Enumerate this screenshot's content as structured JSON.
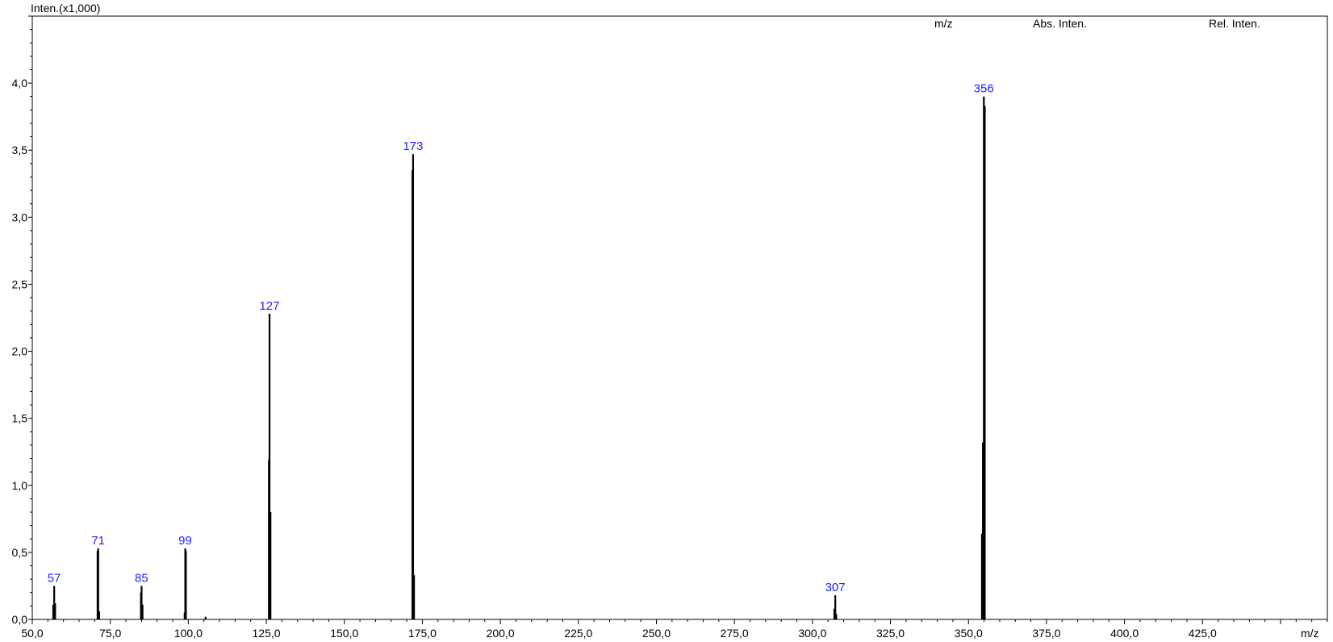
{
  "chart_data": {
    "type": "bar",
    "title": "",
    "ylabel": "Inten.(x1,000)",
    "xlabel": "m/z",
    "xlim": [
      50,
      465
    ],
    "ylim": [
      0,
      4.5
    ],
    "x_ticks": [
      "50,0",
      "75,0",
      "100,0",
      "125,0",
      "150,0",
      "175,0",
      "200,0",
      "225,0",
      "250,0",
      "275,0",
      "300,0",
      "325,0",
      "350,0",
      "375,0",
      "400,0",
      "425,0"
    ],
    "x_tick_values": [
      50,
      75,
      100,
      125,
      150,
      175,
      200,
      225,
      250,
      275,
      300,
      325,
      350,
      375,
      400,
      425
    ],
    "y_ticks": [
      "0,0",
      "0,5",
      "1,0",
      "1,5",
      "2,0",
      "2,5",
      "3,0",
      "3,5",
      "4,0"
    ],
    "y_tick_values": [
      0,
      0.5,
      1.0,
      1.5,
      2.0,
      2.5,
      3.0,
      3.5,
      4.0
    ],
    "header_columns": [
      "m/z",
      "Abs. Inten.",
      "Rel. Inten."
    ],
    "peaks": [
      {
        "mz": 56.7,
        "value": 0.11
      },
      {
        "mz": 57.0,
        "value": 0.25,
        "label": "57"
      },
      {
        "mz": 57.3,
        "value": 0.12
      },
      {
        "mz": 70.9,
        "value": 0.51
      },
      {
        "mz": 71.1,
        "value": 0.53,
        "label": "71"
      },
      {
        "mz": 71.4,
        "value": 0.06
      },
      {
        "mz": 84.8,
        "value": 0.2
      },
      {
        "mz": 85.0,
        "value": 0.25,
        "label": "85"
      },
      {
        "mz": 85.3,
        "value": 0.11
      },
      {
        "mz": 98.8,
        "value": 0.05
      },
      {
        "mz": 99.0,
        "value": 0.53,
        "label": "99"
      },
      {
        "mz": 99.2,
        "value": 0.51
      },
      {
        "mz": 105.5,
        "value": 0.02
      },
      {
        "mz": 125.8,
        "value": 1.19
      },
      {
        "mz": 126.0,
        "value": 2.28,
        "label": "127"
      },
      {
        "mz": 126.3,
        "value": 0.8
      },
      {
        "mz": 171.8,
        "value": 3.35
      },
      {
        "mz": 172.0,
        "value": 3.47,
        "label": "173"
      },
      {
        "mz": 172.3,
        "value": 0.33
      },
      {
        "mz": 307.0,
        "value": 0.08
      },
      {
        "mz": 307.3,
        "value": 0.18,
        "label": "307"
      },
      {
        "mz": 307.6,
        "value": 0.04
      },
      {
        "mz": 354.3,
        "value": 0.64
      },
      {
        "mz": 354.6,
        "value": 1.32
      },
      {
        "mz": 354.9,
        "value": 3.9,
        "label": "356"
      },
      {
        "mz": 355.2,
        "value": 3.83
      }
    ],
    "grid": false,
    "bar_color": "#000000",
    "label_color": "#1f1fff"
  }
}
